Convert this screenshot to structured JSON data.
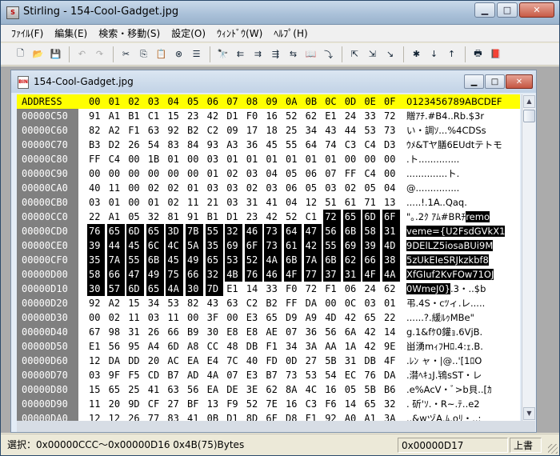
{
  "app": {
    "title": "Stirling - 154-Cool-Gadget.jpg",
    "window_buttons": {
      "minimize": "▁",
      "maximize": "□",
      "close": "✕"
    }
  },
  "menu": [
    {
      "label": "ﾌｧｲﾙ(F)"
    },
    {
      "label": "編集(E)"
    },
    {
      "label": "検索・移動(S)"
    },
    {
      "label": "設定(O)"
    },
    {
      "label": "ｳｨﾝﾄﾞｳ(W)"
    },
    {
      "label": "ﾍﾙﾌﾟ(H)"
    }
  ],
  "toolbar": [
    {
      "icon": "new-file-icon",
      "glyph": "🗋"
    },
    {
      "icon": "open-folder-icon",
      "glyph": "📂"
    },
    {
      "icon": "save-icon",
      "glyph": "💾"
    },
    {
      "sep": true
    },
    {
      "icon": "undo-icon",
      "glyph": "↶",
      "disabled": true
    },
    {
      "icon": "redo-icon",
      "glyph": "↷",
      "disabled": true
    },
    {
      "sep": true
    },
    {
      "icon": "cut-icon",
      "glyph": "✂"
    },
    {
      "icon": "copy-icon",
      "glyph": "⎘"
    },
    {
      "icon": "paste-icon",
      "glyph": "📋"
    },
    {
      "icon": "delete-icon",
      "glyph": "⊗"
    },
    {
      "icon": "select-all-icon",
      "glyph": "☰"
    },
    {
      "sep": true
    },
    {
      "icon": "find-icon",
      "glyph": "🔭"
    },
    {
      "icon": "find-prev-icon",
      "glyph": "⇇"
    },
    {
      "icon": "find-next-icon",
      "glyph": "⇉"
    },
    {
      "icon": "find-hex-icon",
      "glyph": "⇶"
    },
    {
      "icon": "replace-icon",
      "glyph": "⇆"
    },
    {
      "icon": "compare-icon",
      "glyph": "📖"
    },
    {
      "icon": "jump-icon",
      "glyph": "⤵"
    },
    {
      "sep": true
    },
    {
      "icon": "goto-start-icon",
      "glyph": "⇱"
    },
    {
      "icon": "goto-end-icon",
      "glyph": "⇲"
    },
    {
      "icon": "goto-address-icon",
      "glyph": "↘"
    },
    {
      "sep": true
    },
    {
      "icon": "mark-icon",
      "glyph": "✱"
    },
    {
      "icon": "mark-next-icon",
      "glyph": "↓"
    },
    {
      "icon": "mark-prev-icon",
      "glyph": "↑"
    },
    {
      "sep": true
    },
    {
      "icon": "print-icon",
      "glyph": "🖶"
    },
    {
      "icon": "book-icon",
      "glyph": "📕"
    }
  ],
  "document": {
    "title": "154-Cool-Gadget.jpg",
    "header": {
      "address_label": "ADDRESS",
      "columns": [
        "00",
        "01",
        "02",
        "03",
        "04",
        "05",
        "06",
        "07",
        "08",
        "09",
        "0A",
        "0B",
        "0C",
        "0D",
        "0E",
        "0F"
      ],
      "ascii_label": "0123456789ABCDEF"
    },
    "rows": [
      {
        "addr": "00000C50",
        "bytes": [
          "91",
          "A1",
          "B1",
          "C1",
          "15",
          "23",
          "42",
          "D1",
          "F0",
          "16",
          "52",
          "62",
          "E1",
          "24",
          "33",
          "72"
        ],
        "sel_start": -1,
        "sel_end": -1,
        "ascii": "贈ｱﾁ.#B4..Rb.$3r",
        "ascii_sel": ""
      },
      {
        "addr": "00000C60",
        "bytes": [
          "82",
          "A2",
          "F1",
          "63",
          "92",
          "B2",
          "C2",
          "09",
          "17",
          "18",
          "25",
          "34",
          "43",
          "44",
          "53",
          "73"
        ],
        "sel_start": -1,
        "sel_end": -1,
        "ascii": "い・調ｿ...%4CDSs",
        "ascii_sel": ""
      },
      {
        "addr": "00000C70",
        "bytes": [
          "B3",
          "D2",
          "26",
          "54",
          "83",
          "84",
          "93",
          "A3",
          "36",
          "45",
          "55",
          "64",
          "74",
          "C3",
          "C4",
          "D3"
        ],
        "sel_start": -1,
        "sel_end": -1,
        "ascii": "ｳﾒ&Tヤ膳6EUdtテトモ",
        "ascii_sel": ""
      },
      {
        "addr": "00000C80",
        "bytes": [
          "FF",
          "C4",
          "00",
          "1B",
          "01",
          "00",
          "03",
          "01",
          "01",
          "01",
          "01",
          "01",
          "01",
          "00",
          "00",
          "00"
        ],
        "sel_start": -1,
        "sel_end": -1,
        "ascii": ".ト..............",
        "ascii_sel": ""
      },
      {
        "addr": "00000C90",
        "bytes": [
          "00",
          "00",
          "00",
          "00",
          "00",
          "00",
          "01",
          "02",
          "03",
          "04",
          "05",
          "06",
          "07",
          "FF",
          "C4",
          "00"
        ],
        "sel_start": -1,
        "sel_end": -1,
        "ascii": "..............ト.",
        "ascii_sel": ""
      },
      {
        "addr": "00000CA0",
        "bytes": [
          "40",
          "11",
          "00",
          "02",
          "02",
          "01",
          "03",
          "03",
          "02",
          "03",
          "06",
          "05",
          "03",
          "02",
          "05",
          "04"
        ],
        "sel_start": -1,
        "sel_end": -1,
        "ascii": "@...............",
        "ascii_sel": ""
      },
      {
        "addr": "00000CB0",
        "bytes": [
          "03",
          "01",
          "00",
          "01",
          "02",
          "11",
          "21",
          "03",
          "31",
          "41",
          "04",
          "12",
          "51",
          "61",
          "71",
          "13"
        ],
        "sel_start": -1,
        "sel_end": -1,
        "ascii": ".....!.1A..Qaq.",
        "ascii_sel": ""
      },
      {
        "addr": "00000CC0",
        "bytes": [
          "22",
          "A1",
          "05",
          "32",
          "81",
          "91",
          "B1",
          "D1",
          "23",
          "42",
          "52",
          "C1",
          "72",
          "65",
          "6D",
          "6F"
        ],
        "sel_start": 12,
        "sel_end": 15,
        "ascii": "\"｡.2ｸ ｱﾑ#BRﾁ",
        "ascii_sel": "remo"
      },
      {
        "addr": "00000CD0",
        "bytes": [
          "76",
          "65",
          "6D",
          "65",
          "3D",
          "7B",
          "55",
          "32",
          "46",
          "73",
          "64",
          "47",
          "56",
          "6B",
          "58",
          "31"
        ],
        "sel_start": 0,
        "sel_end": 15,
        "ascii": "",
        "ascii_sel": "veme={U2FsdGVkX1"
      },
      {
        "addr": "00000CE0",
        "bytes": [
          "39",
          "44",
          "45",
          "6C",
          "4C",
          "5A",
          "35",
          "69",
          "6F",
          "73",
          "61",
          "42",
          "55",
          "69",
          "39",
          "4D"
        ],
        "sel_start": 0,
        "sel_end": 15,
        "ascii": "",
        "ascii_sel": "9DElLZ5iosaBUi9M"
      },
      {
        "addr": "00000CF0",
        "bytes": [
          "35",
          "7A",
          "55",
          "6B",
          "45",
          "49",
          "65",
          "53",
          "52",
          "4A",
          "6B",
          "7A",
          "6B",
          "62",
          "66",
          "38"
        ],
        "sel_start": 0,
        "sel_end": 15,
        "ascii": "",
        "ascii_sel": "5zUkEIeSRJkzkbf8"
      },
      {
        "addr": "00000D00",
        "bytes": [
          "58",
          "66",
          "47",
          "49",
          "75",
          "66",
          "32",
          "4B",
          "76",
          "46",
          "4F",
          "77",
          "37",
          "31",
          "4F",
          "4A"
        ],
        "sel_start": 0,
        "sel_end": 15,
        "ascii": "",
        "ascii_sel": "XfGIuf2KvFOw71OJ"
      },
      {
        "addr": "00000D10",
        "bytes": [
          "30",
          "57",
          "6D",
          "65",
          "4A",
          "30",
          "7D",
          "E1",
          "14",
          "33",
          "F0",
          "72",
          "F1",
          "06",
          "24",
          "62"
        ],
        "sel_start": 0,
        "sel_end": 6,
        "ascii": ".3・..$b",
        "ascii_sel": "0WmeJ0}"
      },
      {
        "addr": "00000D20",
        "bytes": [
          "92",
          "A2",
          "15",
          "34",
          "53",
          "82",
          "43",
          "63",
          "C2",
          "B2",
          "FF",
          "DA",
          "00",
          "0C",
          "03",
          "01"
        ],
        "sel_start": -1,
        "sel_end": -1,
        "ascii": "弔.4S・cﾂィ.レ.....",
        "ascii_sel": ""
      },
      {
        "addr": "00000D30",
        "bytes": [
          "00",
          "02",
          "11",
          "03",
          "11",
          "00",
          "3F",
          "00",
          "E3",
          "65",
          "D9",
          "A9",
          "4D",
          "42",
          "65",
          "22"
        ],
        "sel_start": -1,
        "sel_end": -1,
        "ascii": "......?.緩ﾙｩMBe\"",
        "ascii_sel": ""
      },
      {
        "addr": "00000D40",
        "bytes": [
          "67",
          "98",
          "31",
          "26",
          "66",
          "B9",
          "30",
          "E8",
          "E8",
          "AE",
          "07",
          "36",
          "56",
          "6A",
          "42",
          "14"
        ],
        "sel_start": -1,
        "sel_end": -1,
        "ascii": "g.1&fｹ0鑵ｮ.6VjB.",
        "ascii_sel": ""
      },
      {
        "addr": "00000D50",
        "bytes": [
          "E1",
          "56",
          "95",
          "A4",
          "6D",
          "A8",
          "CC",
          "48",
          "DB",
          "F1",
          "34",
          "3A",
          "AA",
          "1A",
          "42",
          "9E"
        ],
        "sel_start": -1,
        "sel_end": -1,
        "ascii": "畄湧mｨﾌHﾛ.4:ｪ.B.",
        "ascii_sel": ""
      },
      {
        "addr": "00000D60",
        "bytes": [
          "12",
          "DA",
          "DD",
          "20",
          "AC",
          "EA",
          "E4",
          "7C",
          "40",
          "FD",
          "0D",
          "27",
          "5B",
          "31",
          "DB",
          "4F"
        ],
        "sel_start": -1,
        "sel_end": -1,
        "ascii": ".ﾚﾝ ャ・|@..'[1ﾛO",
        "ascii_sel": ""
      },
      {
        "addr": "00000D70",
        "bytes": [
          "03",
          "9F",
          "F5",
          "CD",
          "B7",
          "AD",
          "4A",
          "07",
          "E3",
          "B7",
          "73",
          "53",
          "54",
          "EC",
          "76",
          "DA"
        ],
        "sel_start": -1,
        "sel_end": -1,
        "ascii": ".潸ﾍｷｭJ.鴇sST・レ",
        "ascii_sel": ""
      },
      {
        "addr": "00000D80",
        "bytes": [
          "15",
          "65",
          "25",
          "41",
          "63",
          "56",
          "EA",
          "DE",
          "3E",
          "62",
          "8A",
          "4C",
          "16",
          "05",
          "5B",
          "B6"
        ],
        "sel_start": -1,
        "sel_end": -1,
        "ascii": ".e%AcV・ﾞ>b貝..[ｶ",
        "ascii_sel": ""
      },
      {
        "addr": "00000D90",
        "bytes": [
          "11",
          "20",
          "9D",
          "CF",
          "27",
          "BF",
          "13",
          "F9",
          "52",
          "7E",
          "16",
          "C3",
          "F6",
          "14",
          "65",
          "32"
        ],
        "sel_start": -1,
        "sel_end": -1,
        "ascii": ". 斫'ｿ.・R~.ﾃ..e2",
        "ascii_sel": ""
      },
      {
        "addr": "00000DA0",
        "bytes": [
          "12",
          "12",
          "26",
          "77",
          "83",
          "41",
          "0B",
          "D1",
          "8D",
          "6F",
          "D8",
          "F1",
          "92",
          "A0",
          "A1",
          "3A"
        ],
        "sel_start": -1,
        "sel_end": -1,
        "ascii": "..&wヅA.ﾑ.oﾘ・..:",
        "ascii_sel": ""
      }
    ]
  },
  "status": {
    "selection": "選択：0x00000CCC～0x00000D16  0x4B(75)Bytes",
    "cursor": "0x00000D17",
    "mode": "上書"
  }
}
